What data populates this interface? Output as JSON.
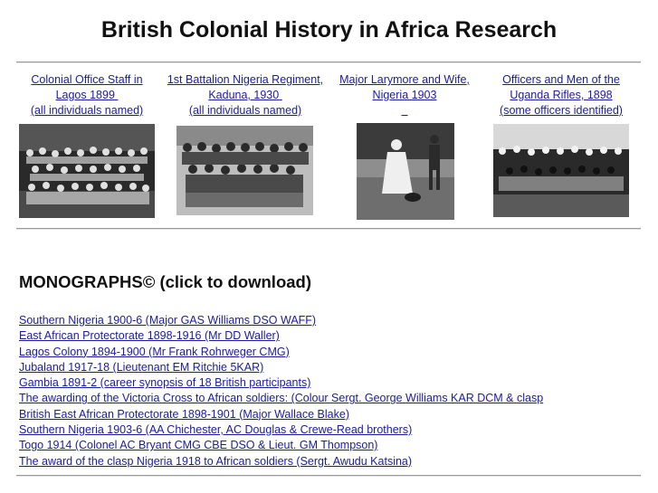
{
  "page": {
    "title": "British Colonial History in Africa Research"
  },
  "gallery": [
    {
      "line1": "Colonial Office Staff in",
      "line2": "Lagos 1899",
      "line3": "(all individuals named)",
      "image_alt": "Group photograph of Colonial Office staff"
    },
    {
      "line1": "1st Battalion Nigeria Regiment,",
      "line2": "Kaduna, 1930",
      "line3": "(all individuals named)",
      "image_alt": "Group photograph of soldiers in uniform"
    },
    {
      "line1": "Major Larymore and Wife,",
      "line2": "Nigeria 1903",
      "line3": "",
      "image_alt": "Photograph of a man and woman outdoors"
    },
    {
      "line1": "Officers and Men of the",
      "line2": "Uganda Rifles, 1898",
      "line3": "(some officers identified)",
      "image_alt": "Group photograph of officers and men"
    }
  ],
  "monographs": {
    "heading": "MONOGRAPHS© (click to download)",
    "items": [
      "Southern Nigeria 1900-6 (Major GAS Williams DSO WAFF)",
      "East African Protectorate 1898-1916 (Mr DD Waller)",
      "Lagos Colony 1894-1900 (Mr Frank Rohrweger CMG)",
      "Jubaland 1917-18 (Lieutenant EM Ritchie 5KAR)",
      "Gambia 1891-2 (career synopsis of 18 British participants)",
      "The awarding of the Victoria Cross to African soldiers: (Colour Sergt. George Williams KAR DCM & clasp",
      "British East African Protectorate 1898-1901 (Major Wallace Blake)",
      "Southern Nigeria 1903-6 (AA Chichester, AC Douglas & Crewe-Read brothers)",
      "Togo 1914 (Colonel AC Bryant CMG CBE DSO & Lieut. GM Thompson)",
      "The award of the clasp Nigeria 1918 to African soldiers (Sergt. Awudu Katsina)"
    ]
  }
}
